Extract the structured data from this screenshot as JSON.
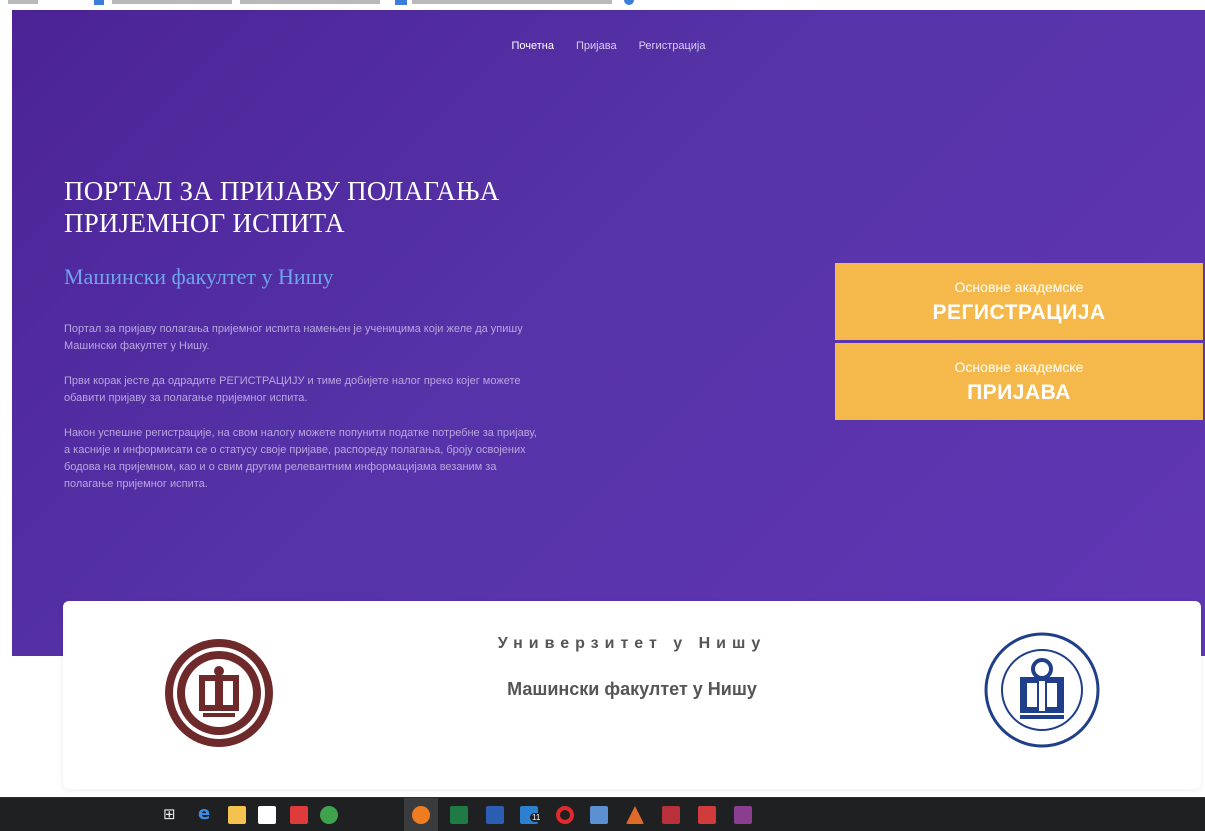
{
  "nav": {
    "items": [
      "Почетна",
      "Пријава",
      "Регистрација"
    ],
    "active_index": 0
  },
  "hero": {
    "title": "ПОРТАЛ ЗА ПРИЈАВУ ПОЛАГАЊА ПРИЈЕМНОГ ИСПИТА",
    "subtitle": "Машински факултет у Нишу",
    "paragraphs": [
      "Портал за пријаву полагања пријемног испита намењен је ученицима који желе да упишу Машински факултет у Нишу.",
      "Први корак јесте да одрадите РЕГИСТРАЦИЈУ и тиме добијете налог преко којег можете обавити пријаву за полагање пријемног испита.",
      "Након успешне регистрације, на свом налогу можете попунити податке потребне за пријаву, а касније и информисати се о статусу своје пријаве, распореду полагања, броју освојених бодова на пријемном, као и о свим другим релевантним информацијама везаним за полагање пријемног испита."
    ]
  },
  "cta": {
    "registration": {
      "small": "Основне академске",
      "big": "РЕГИСТРАЦИЈА"
    },
    "login": {
      "small": "Основне академске",
      "big": "ПРИЈАВА"
    }
  },
  "footer_card": {
    "title1": "Универзитет у Нишу",
    "title2": "Машински факултет у Нишу"
  },
  "taskbar": {
    "icons": [
      "task-view-icon",
      "edge-icon",
      "file-explorer-icon",
      "store-icon",
      "app-icon",
      "chrome-icon",
      "firefox-icon",
      "excel-icon",
      "word-icon",
      "mail-icon",
      "opera-icon",
      "remote-desktop-icon",
      "matlab-icon",
      "access-icon",
      "settings-app-icon",
      "winrar-icon"
    ],
    "mail_badge": "11"
  },
  "colors": {
    "hero_start": "#4b2396",
    "hero_end": "#6136b4",
    "subtitle": "#6fa3ec",
    "cta": "#f5b84b",
    "taskbar": "#1f2021"
  }
}
